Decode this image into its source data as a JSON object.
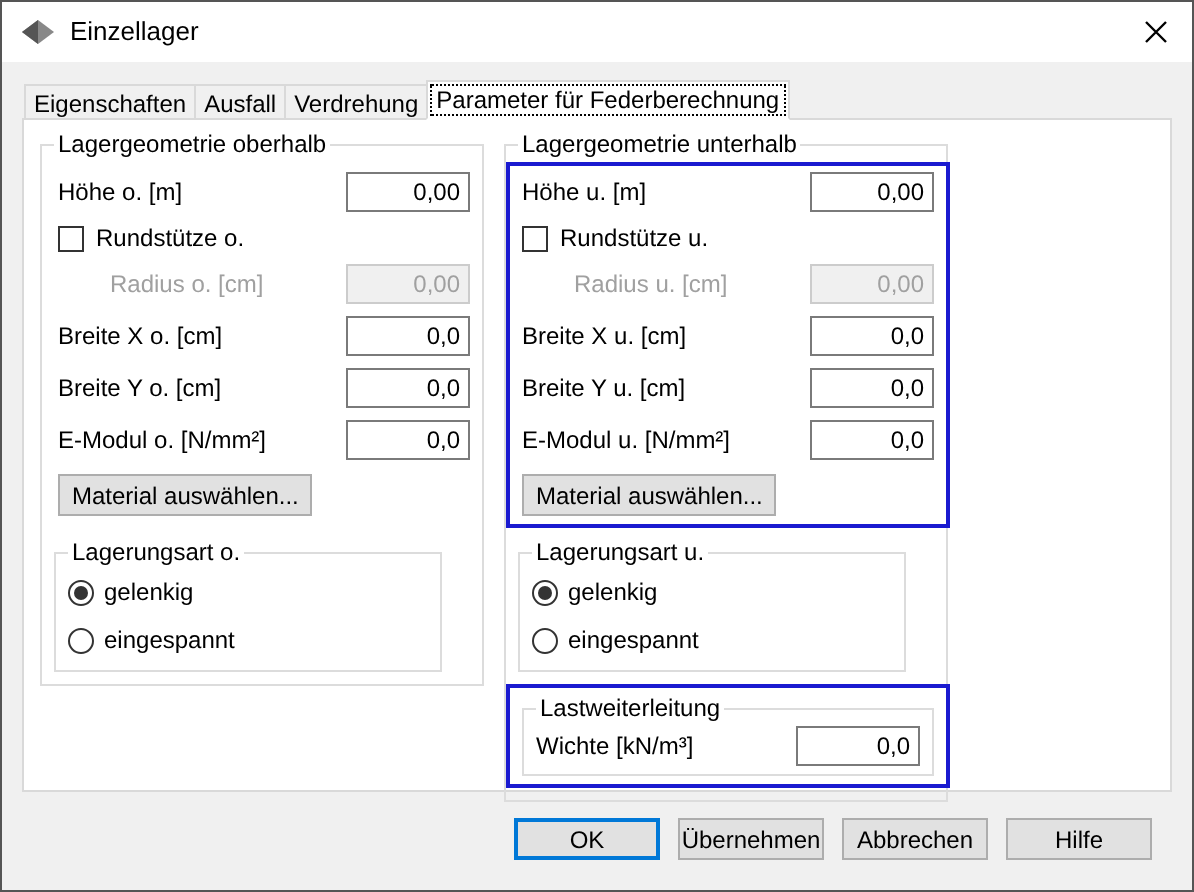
{
  "window": {
    "title": "Einzellager"
  },
  "tabs": [
    {
      "label": "Eigenschaften",
      "selected": false
    },
    {
      "label": "Ausfall",
      "selected": false
    },
    {
      "label": "Verdrehung",
      "selected": false
    },
    {
      "label": "Parameter für Federberechnung",
      "selected": true
    }
  ],
  "groups": [
    {
      "title": "Lagergeometrie oberhalb",
      "highlighted": false,
      "rows": [
        {
          "kind": "field",
          "label": "Höhe o. [m]",
          "value": "0,00",
          "disabled": false
        },
        {
          "kind": "checkbox",
          "label": "Rundstütze o.",
          "checked": false
        },
        {
          "kind": "field",
          "label": "Radius o. [cm]",
          "value": "0,00",
          "disabled": true
        },
        {
          "kind": "field",
          "label": "Breite X o. [cm]",
          "value": "0,0",
          "disabled": false
        },
        {
          "kind": "field",
          "label": "Breite Y o. [cm]",
          "value": "0,0",
          "disabled": false
        },
        {
          "kind": "field",
          "label": "E-Modul o. [N/mm²]",
          "value": "0,0",
          "disabled": false
        }
      ],
      "button": "Material auswählen...",
      "support": {
        "title": "Lagerungsart o.",
        "options": [
          {
            "label": "gelenkig",
            "selected": true
          },
          {
            "label": "eingespannt",
            "selected": false
          }
        ]
      }
    },
    {
      "title": "Lagergeometrie unterhalb",
      "highlighted": true,
      "rows": [
        {
          "kind": "field",
          "label": "Höhe u. [m]",
          "value": "0,00",
          "disabled": false
        },
        {
          "kind": "checkbox",
          "label": "Rundstütze u.",
          "checked": false
        },
        {
          "kind": "field",
          "label": "Radius u. [cm]",
          "value": "0,00",
          "disabled": true
        },
        {
          "kind": "field",
          "label": "Breite X u. [cm]",
          "value": "0,0",
          "disabled": false
        },
        {
          "kind": "field",
          "label": "Breite Y u. [cm]",
          "value": "0,0",
          "disabled": false
        },
        {
          "kind": "field",
          "label": "E-Modul u. [N/mm²]",
          "value": "0,0",
          "disabled": false
        }
      ],
      "button": "Material auswählen...",
      "support": {
        "title": "Lagerungsart u.",
        "options": [
          {
            "label": "gelenkig",
            "selected": true
          },
          {
            "label": "eingespannt",
            "selected": false
          }
        ]
      },
      "load": {
        "title": "Lastweiterleitung",
        "label": "Wichte [kN/m³]",
        "value": "0,0",
        "highlighted": true
      }
    }
  ],
  "buttons": [
    {
      "label": "OK",
      "default": true
    },
    {
      "label": "Übernehmen",
      "default": false
    },
    {
      "label": "Abbrechen",
      "default": false
    },
    {
      "label": "Hilfe",
      "default": false
    }
  ]
}
